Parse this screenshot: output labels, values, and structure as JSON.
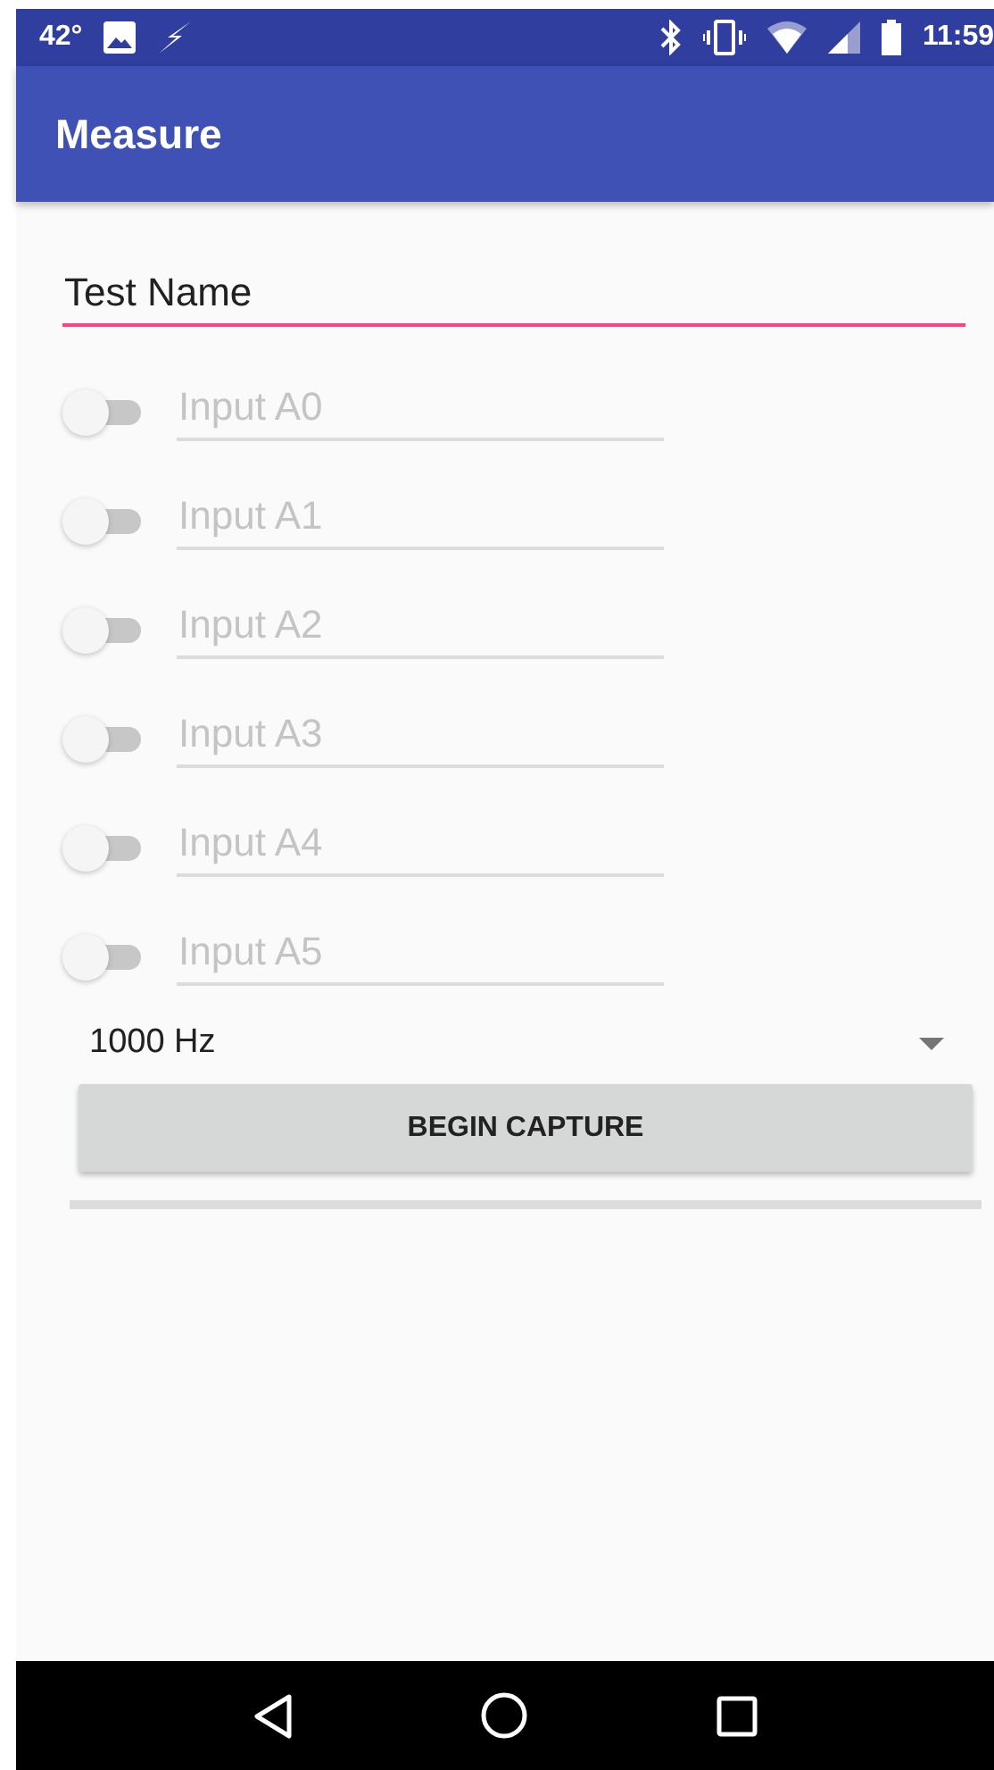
{
  "status_bar": {
    "temperature": "42°",
    "time": "11:59"
  },
  "app_bar": {
    "title": "Measure"
  },
  "test_name": {
    "value": "Test Name",
    "focused": true
  },
  "inputs": [
    {
      "placeholder": "Input A0",
      "on": false,
      "disabled": true
    },
    {
      "placeholder": "Input A1",
      "on": false,
      "disabled": true
    },
    {
      "placeholder": "Input A2",
      "on": false,
      "disabled": true
    },
    {
      "placeholder": "Input A3",
      "on": false,
      "disabled": true
    },
    {
      "placeholder": "Input A4",
      "on": false,
      "disabled": true
    },
    {
      "placeholder": "Input A5",
      "on": false,
      "disabled": true
    }
  ],
  "rate_select": {
    "value": "1000 Hz"
  },
  "capture_button": {
    "label": "BEGIN CAPTURE"
  },
  "progress": {
    "level": 0
  }
}
